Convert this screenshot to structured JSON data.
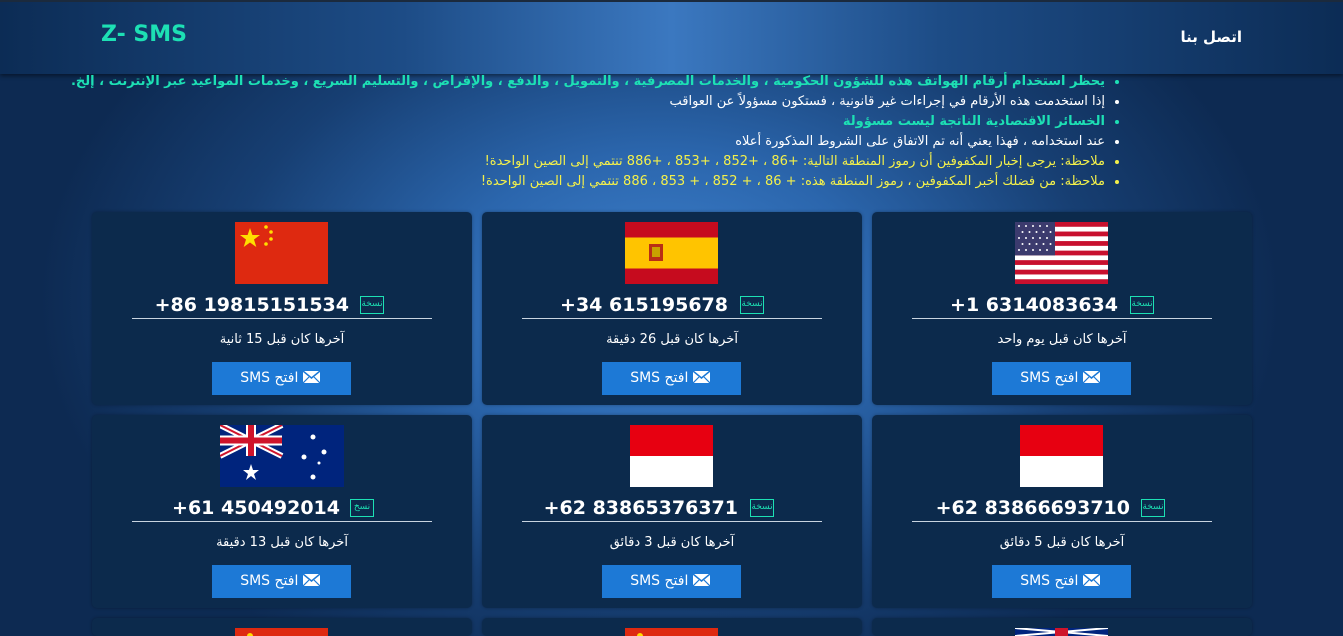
{
  "header": {
    "logo": "Z- SMS",
    "contact": "اتصل بنا"
  },
  "notices": [
    {
      "text": "يحظر استخدام أرقام الهواتف هذه للشؤون الحكومية ، والخدمات المصرفية ، والتمويل ، والدفع ، والإقراض ، والتسليم السريع ، وخدمات المواعيد عبر الإنترنت ، إلخ.",
      "color": "green"
    },
    {
      "text": "إذا استخدمت هذه الأرقام في إجراءات غير قانونية ، فستكون مسؤولاً عن العواقب",
      "color": "white"
    },
    {
      "text": "الخسائر الاقتصادية الناتجة ليست مسؤولة",
      "color": "green"
    },
    {
      "text": "عند استخدامه ، فهذا يعني أنه تم الاتفاق على الشروط المذكورة أعلاه",
      "color": "white"
    },
    {
      "text": "ملاحظة: يرجى إخبار المكفوفين أن رموز المنطقة التالية: +86 ، +852 ، +853 ، +886 تنتمي إلى الصين الواحدة!",
      "color": "yellow"
    },
    {
      "text": "ملاحظة: من فضلك أخبر المكفوفين ، رموز المنطقة هذه: + 86 ، + 852 ، + 853 ، 886 تنتمي إلى الصين الواحدة!",
      "color": "yellow"
    }
  ],
  "cards": [
    {
      "flag": "usa-flag",
      "number": "+1 6314083634",
      "copy_label": "نسخة",
      "last": "آخرها كان قبل يوم واحد",
      "button": "SMS افتح"
    },
    {
      "flag": "spain-flag",
      "number": "+34 615195678",
      "copy_label": "نسخة",
      "last": "آخرها كان قبل 26 دقيقة",
      "button": "SMS افتح"
    },
    {
      "flag": "china-flag",
      "number": "+86 19815151534",
      "copy_label": "نسخة",
      "last": "آخرها كان قبل 15 ثانية",
      "button": "SMS افتح"
    },
    {
      "flag": "indonesia-flag",
      "number": "+62 83866693710",
      "copy_label": "نسخة",
      "last": "آخرها كان قبل 5 دقائق",
      "button": "SMS افتح"
    },
    {
      "flag": "indonesia-flag",
      "number": "+62 83865376371",
      "copy_label": "نسخة",
      "last": "آخرها كان قبل 3 دقائق",
      "button": "SMS افتح"
    },
    {
      "flag": "australia-flag",
      "number": "+61 450492014",
      "copy_label": "نسخ",
      "last": "آخرها كان قبل 13 دقيقة",
      "button": "SMS افتح"
    }
  ],
  "colors": {
    "accent": "#1de0b4",
    "button": "#1d79d6",
    "card": "#0c2a4c",
    "notice_yellow": "#f3f04b"
  }
}
